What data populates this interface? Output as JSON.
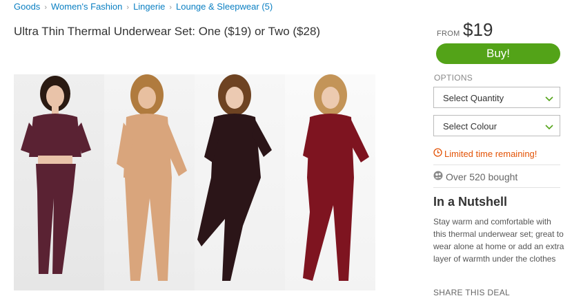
{
  "breadcrumb": {
    "items": [
      "Goods",
      "Women's Fashion",
      "Lingerie",
      "Lounge & Sleepwear (5)"
    ]
  },
  "deal": {
    "title": "Ultra Thin Thermal Underwear Set: One ($19) or Two ($28)"
  },
  "gallery": {
    "models": [
      {
        "color": "#5a2233",
        "skin": "#e9c3a9",
        "hair": "#2a1a12"
      },
      {
        "color": "#d9a57c",
        "skin": "#e8c0a0",
        "hair": "#b07b3e"
      },
      {
        "color": "#2b1518",
        "skin": "#eccab2",
        "hair": "#6e4322"
      },
      {
        "color": "#7e1420",
        "skin": "#eccab0",
        "hair": "#c39458"
      }
    ]
  },
  "price": {
    "from_label": "FROM",
    "amount": "$19"
  },
  "buy": {
    "label": "Buy!",
    "color": "#53a318"
  },
  "options": {
    "label": "OPTIONS",
    "quantity_placeholder": "Select Quantity",
    "colour_placeholder": "Select Colour"
  },
  "urgency": {
    "limited_text": "Limited time remaining!",
    "color": "#e35205"
  },
  "social_proof": {
    "bought_text": "Over 520 bought"
  },
  "nutshell": {
    "title": "In a Nutshell",
    "text": "Stay warm and comfortable with this thermal underwear set; great to wear alone at home or add an extra layer of warmth under the clothes"
  },
  "share": {
    "label": "SHARE THIS DEAL"
  }
}
